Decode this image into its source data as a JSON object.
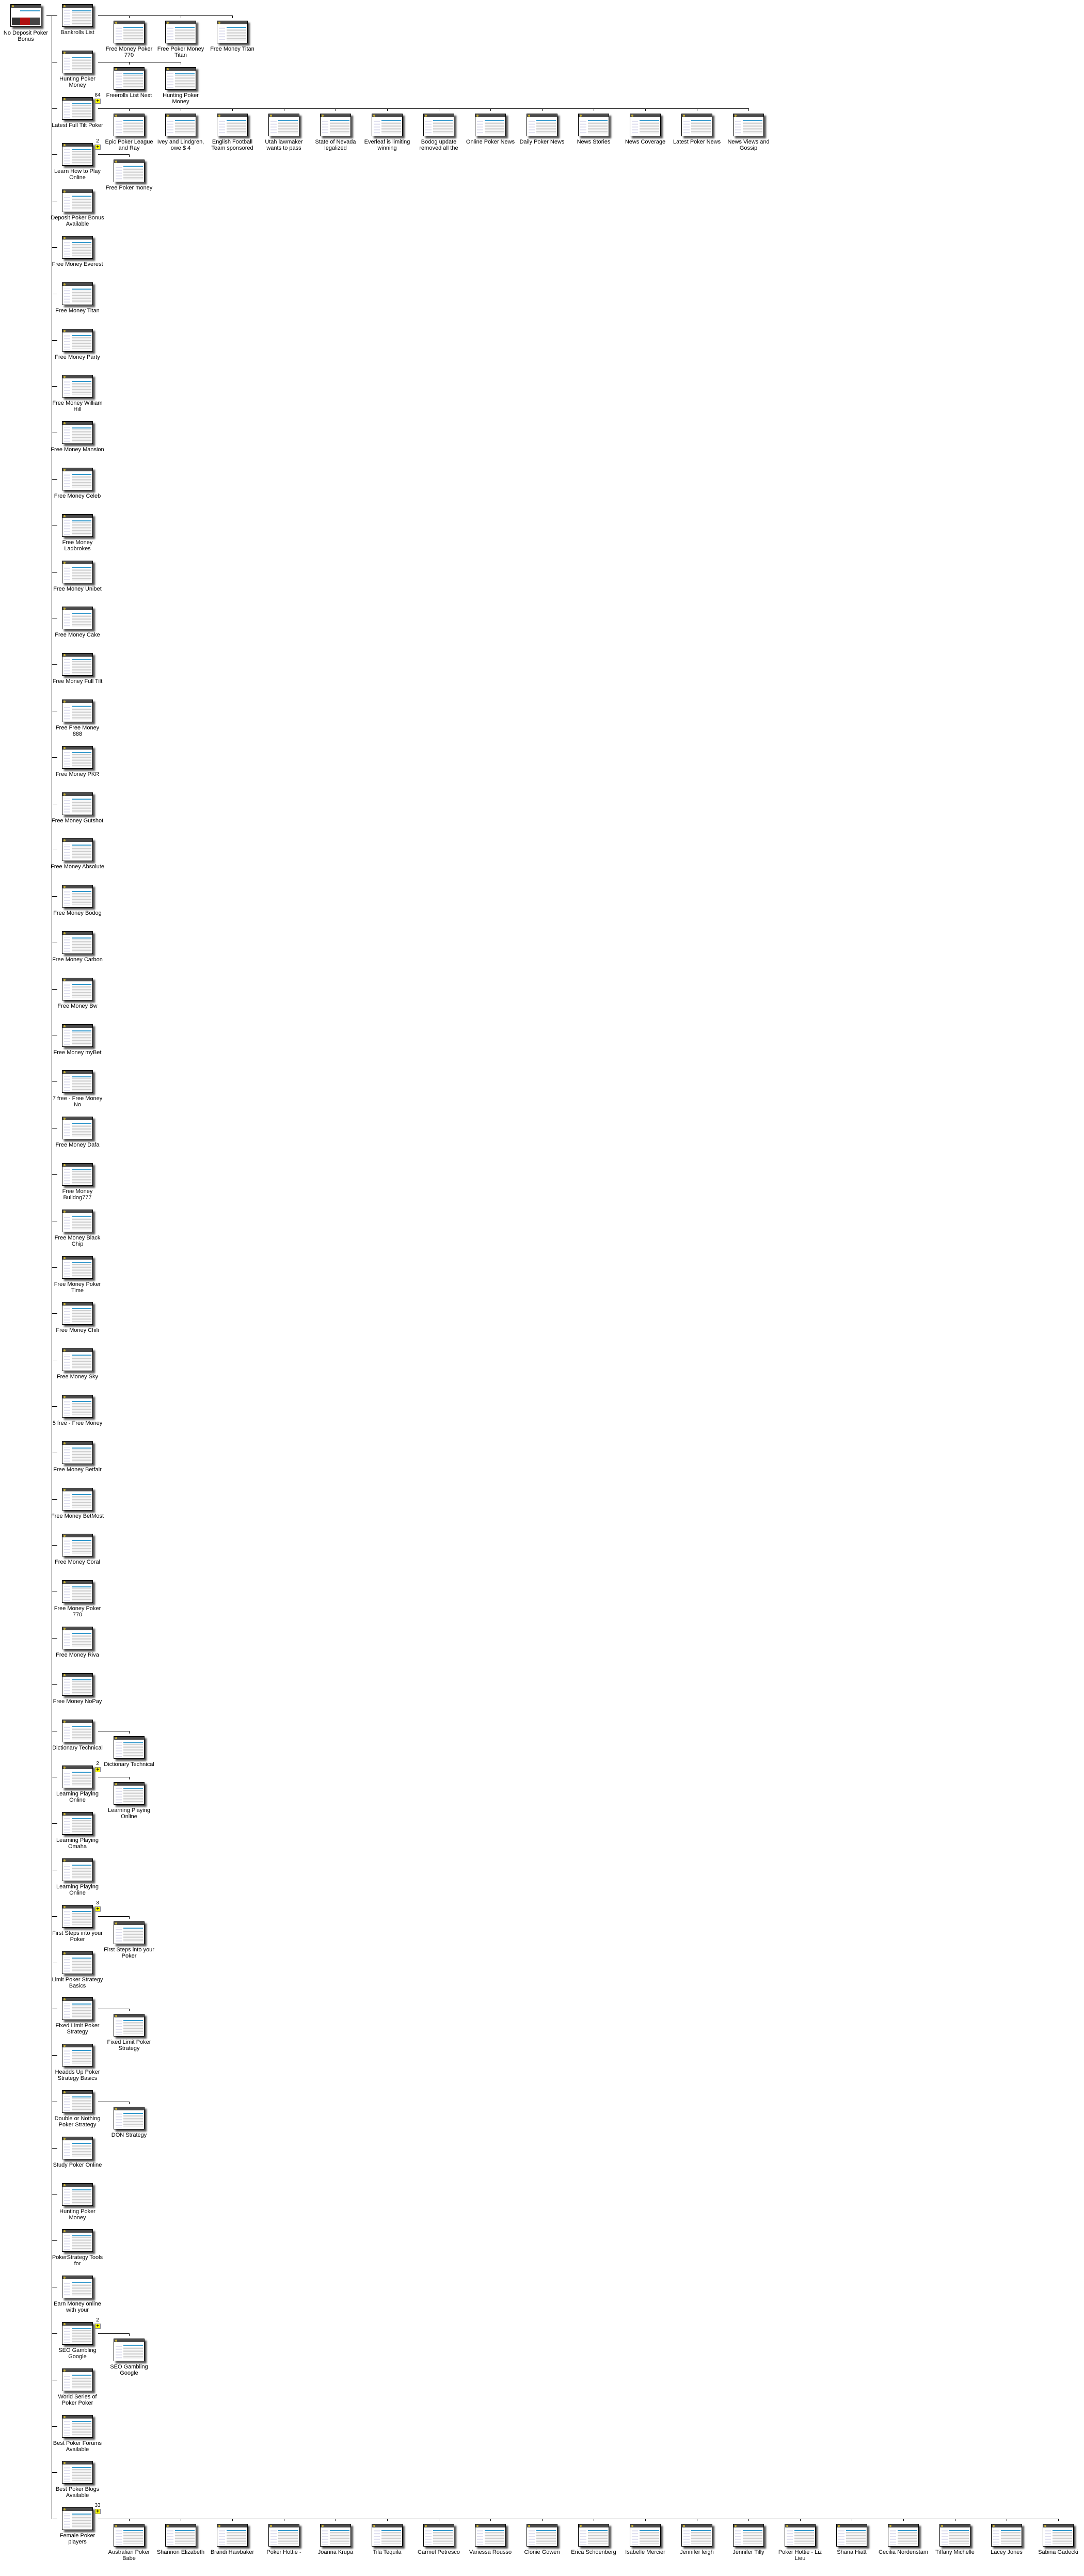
{
  "root": {
    "label": "No Deposit Poker Bonus"
  },
  "expand_icon": "plus-icon",
  "badge_color": "#ffff00",
  "rows": [
    {
      "label": "Bankrolls List",
      "children": [
        "Free Money Poker 770",
        "Free Poker Money Titan",
        "Free Money Titan"
      ]
    },
    {
      "label": "Hunting Poker Money",
      "children": [
        "Freerolls List Next",
        "Hunting Poker Money"
      ]
    },
    {
      "label": "Latest Full Tilt Poker",
      "badge": "84",
      "children": [
        "Epic Poker League and Ray",
        "Ivey and Lindgren, owe $ 4",
        "English Football Team sponsored",
        "Utah lawmaker wants to pass",
        "State of Nevada legalized",
        "Everleaf is limiting winning",
        "Bodog update removed all the",
        "Online Poker News",
        "Daily Poker News",
        "News Stories",
        "News Coverage",
        "Latest Poker News",
        "News Views and Gossip"
      ]
    },
    {
      "label": "Learn How to Play Online",
      "badge": "2",
      "children": [
        "Free Poker money"
      ]
    },
    {
      "label": "Deposit Poker Bonus Available"
    },
    {
      "label": "Free Money Everest"
    },
    {
      "label": "Free Money Titan"
    },
    {
      "label": "Free Money Party"
    },
    {
      "label": "Free Money William Hill"
    },
    {
      "label": "Free Money Mansion"
    },
    {
      "label": "Free Money Celeb"
    },
    {
      "label": "Free Money Ladbrokes"
    },
    {
      "label": "Free Money Unibet"
    },
    {
      "label": "Free Money Cake"
    },
    {
      "label": "Free Money Full Tilt"
    },
    {
      "label": "Free Free Money 888"
    },
    {
      "label": "Free Money PKR"
    },
    {
      "label": "Free Money Gutshot"
    },
    {
      "label": "Free Money Absolute"
    },
    {
      "label": "Free Money Bodog"
    },
    {
      "label": "Free Money Carbon"
    },
    {
      "label": "Free Money Bw"
    },
    {
      "label": "Free Money myBet"
    },
    {
      "label": "7 free - Free Money No"
    },
    {
      "label": "Free Money Dafa"
    },
    {
      "label": "Free Money Bulldog777"
    },
    {
      "label": "Free Money Black Chip"
    },
    {
      "label": "Free Money Poker Time"
    },
    {
      "label": "Free Money Chili"
    },
    {
      "label": "Free Money Sky"
    },
    {
      "label": "5 free - Free Money"
    },
    {
      "label": "Free Money Betfair"
    },
    {
      "label": "Free Money BetMost"
    },
    {
      "label": "Free Money Coral"
    },
    {
      "label": "Free Money Poker 770"
    },
    {
      "label": "Free Money Riva"
    },
    {
      "label": "Free Money NoPay"
    },
    {
      "label": "Dictionary Technical",
      "children": [
        "Dictionary Technical"
      ]
    },
    {
      "label": "Learning Playing Online",
      "badge": "2",
      "children": [
        "Learning Playing Online"
      ]
    },
    {
      "label": "Learning Playing Omaha"
    },
    {
      "label": "Learning Playing Online"
    },
    {
      "label": "First Steps into your Poker",
      "badge": "3",
      "children": [
        "First Steps into your Poker"
      ]
    },
    {
      "label": "Limit Poker Strategy Basics"
    },
    {
      "label": "Fixed Limit Poker Strategy",
      "children": [
        "Fixed Limit Poker Strategy"
      ]
    },
    {
      "label": "Headds Up Poker Strategy Basics"
    },
    {
      "label": "Double or Nothing Poker Strategy",
      "children": [
        "DON Strategy"
      ]
    },
    {
      "label": "Study Poker Online"
    },
    {
      "label": "Hunting Poker Money"
    },
    {
      "label": "PokerStrategy Tools for"
    },
    {
      "label": "Earn Money online with your"
    },
    {
      "label": "SEO Gambling Google",
      "badge": "2",
      "children": [
        "SEO Gambling Google"
      ]
    },
    {
      "label": "World Series of Poker Poker"
    },
    {
      "label": "Best Poker Forums Available"
    },
    {
      "label": "Best Poker Blogs Available"
    },
    {
      "label": "Female Poker players",
      "badge": "33",
      "children": [
        "Australian Poker Babe",
        "Shannon Elizabeth",
        "Brandi Hawbaker",
        "Poker Hottie -",
        "Joanna Krupa",
        "Tila Tequila",
        "Carmel Petresco",
        "Vanessa Rousso",
        "Clonie Gowen",
        "Erica Schoenberg",
        "Isabelle Mercier",
        "Jennifer leigh",
        "Jennifer Tilly",
        "Poker Hottie - Liz Lieu",
        "Shana Hiatt",
        "Cecilia Nordenstam",
        "Tiffany Michelle",
        "Lacey Jones",
        "Sabina Gadecki"
      ]
    }
  ]
}
